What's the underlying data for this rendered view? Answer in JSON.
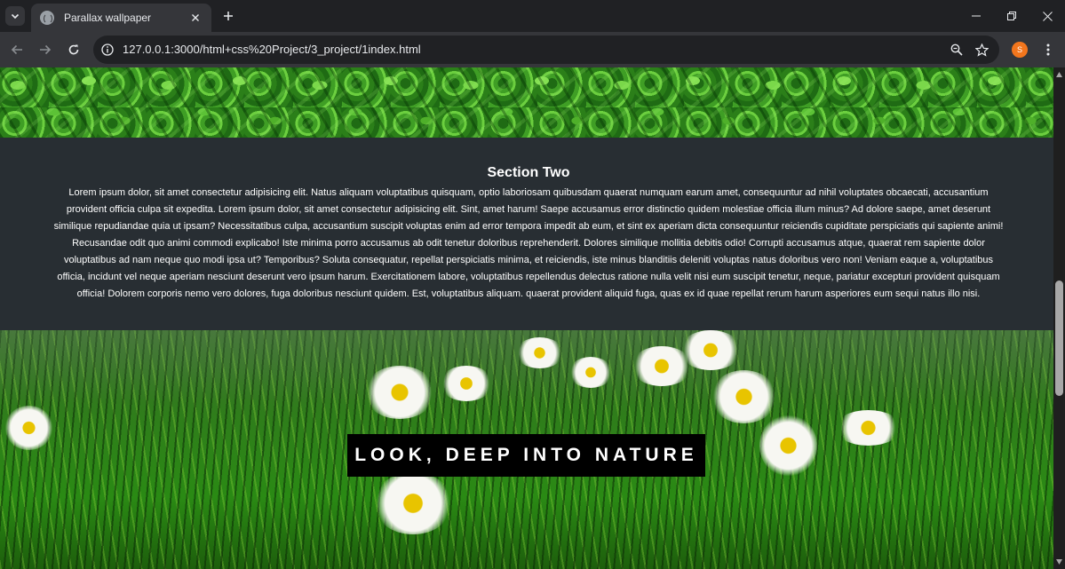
{
  "browser": {
    "tab_title": "Parallax wallpaper",
    "url": "127.0.0.1:3000/html+css%20Project/3_project/1index.html",
    "profile_initial": "S",
    "accent_color": "#f2761d"
  },
  "page": {
    "section_two": {
      "heading": "Section Two",
      "body": "Lorem ipsum dolor, sit amet consectetur adipisicing elit. Natus aliquam voluptatibus quisquam, optio laboriosam quibusdam quaerat numquam earum amet, consequuntur ad nihil voluptates obcaecati, accusantium provident officia culpa sit expedita. Lorem ipsum dolor, sit amet consectetur adipisicing elit. Sint, amet harum! Saepe accusamus error distinctio quidem molestiae officia illum minus? Ad dolore saepe, amet deserunt similique repudiandae quia ut ipsam? Necessitatibus culpa, accusantium suscipit voluptas enim ad error tempora impedit ab eum, et sint ex aperiam dicta consequuntur reiciendis cupiditate perspiciatis qui sapiente animi! Recusandae odit quo animi commodi explicabo! Iste minima porro accusamus ab odit tenetur doloribus reprehenderit. Dolores similique mollitia debitis odio! Corrupti accusamus atque, quaerat rem sapiente dolor voluptatibus ad nam neque quo modi ipsa ut? Temporibus? Soluta consequatur, repellat perspiciatis minima, et reiciendis, iste minus blanditiis deleniti voluptas natus doloribus vero non! Veniam eaque a, voluptatibus officia, incidunt vel neque aperiam nesciunt deserunt vero ipsum harum. Exercitationem labore, voluptatibus repellendus delectus ratione nulla velit nisi eum suscipit tenetur, neque, pariatur excepturi provident quisquam officia! Dolorem corporis nemo vero dolores, fuga doloribus nesciunt quidem. Est, voluptatibus aliquam. quaerat provident aliquid fuga, quas ex id quae repellat rerum harum asperiores eum sequi natus illo nisi."
    },
    "banner_text": "LOOK, DEEP INTO NATURE"
  },
  "icons": {
    "tab_search": "chevron-down-icon",
    "tab_favicon": "globe-icon",
    "tab_close": "close-icon",
    "new_tab": "plus-icon",
    "back": "arrow-left-icon",
    "forward": "arrow-right-icon",
    "reload": "reload-icon",
    "site_info": "info-icon",
    "zoom": "zoom-icon",
    "bookmark": "star-icon",
    "menu": "kebab-menu-icon"
  }
}
